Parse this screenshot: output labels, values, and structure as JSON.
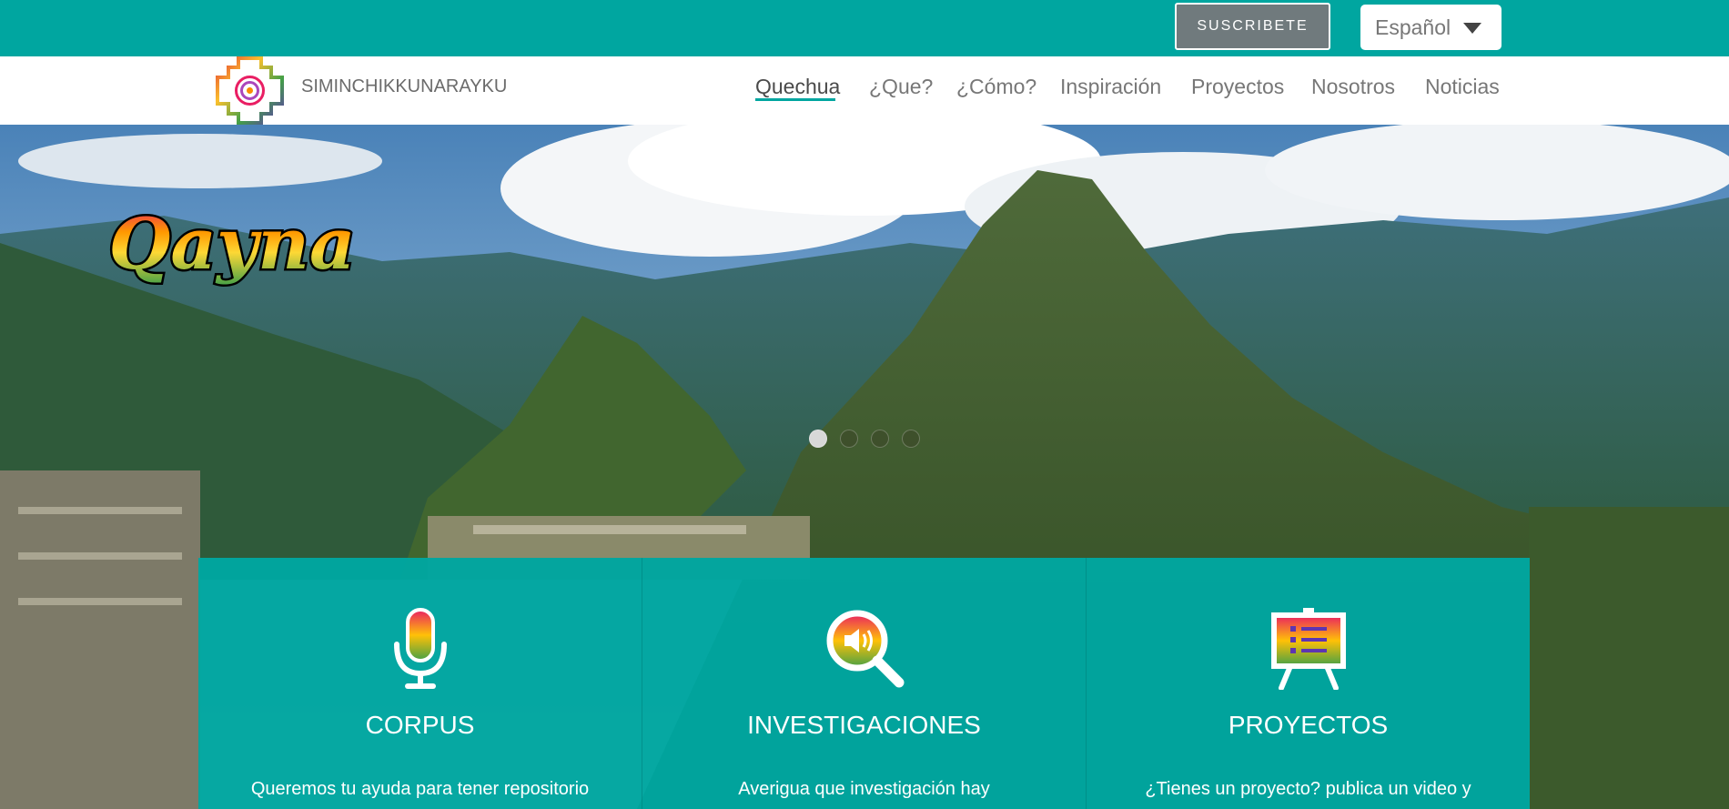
{
  "topbar": {
    "subscribe_label": "SUSCRIBETE",
    "language": "Español"
  },
  "brand": {
    "name": "SIMINCHIKKUNARAYKU"
  },
  "nav": {
    "items": [
      {
        "label": "Quechua",
        "active": true
      },
      {
        "label": "¿Que?",
        "active": false
      },
      {
        "label": "¿Cómo?",
        "active": false
      },
      {
        "label": "Inspiración",
        "active": false
      },
      {
        "label": "Proyectos",
        "active": false
      },
      {
        "label": "Nosotros",
        "active": false
      },
      {
        "label": "Noticias",
        "active": false
      }
    ]
  },
  "hero": {
    "logo_text": "Qayna",
    "slide_count": 4,
    "active_slide": 1
  },
  "cards": [
    {
      "icon": "microphone-icon",
      "title": "CORPUS",
      "text": "Queremos tu ayuda para tener repositorio"
    },
    {
      "icon": "magnifier-sound-icon",
      "title": "INVESTIGACIONES",
      "text": "Averigua que investigación hay"
    },
    {
      "icon": "presentation-board-icon",
      "title": "PROYECTOS",
      "text": "¿Tienes un proyecto? publica un video y"
    }
  ],
  "colors": {
    "accent": "#00a6a0",
    "subscribe_bg": "#707a7d"
  }
}
